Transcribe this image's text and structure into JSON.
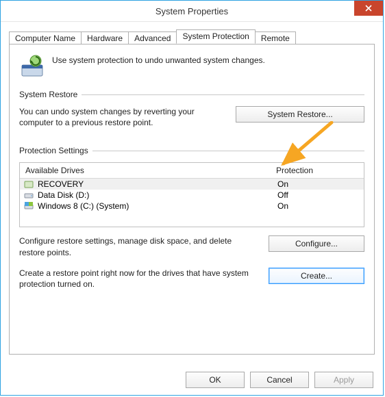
{
  "window": {
    "title": "System Properties"
  },
  "tabs": {
    "computer_name": "Computer Name",
    "hardware": "Hardware",
    "advanced": "Advanced",
    "system_protection": "System Protection",
    "remote": "Remote"
  },
  "intro_text": "Use system protection to undo unwanted system changes.",
  "restore": {
    "heading": "System Restore",
    "text": "You can undo system changes by reverting your computer to a previous restore point.",
    "button": "System Restore..."
  },
  "protection": {
    "heading": "Protection Settings",
    "col_drive": "Available Drives",
    "col_prot": "Protection",
    "drives": [
      {
        "name": "RECOVERY",
        "status": "On",
        "icon": "drive-recovery"
      },
      {
        "name": "Data Disk (D:)",
        "status": "Off",
        "icon": "drive-data"
      },
      {
        "name": "Windows 8 (C:) (System)",
        "status": "On",
        "icon": "drive-system"
      }
    ],
    "configure_text": "Configure restore settings, manage disk space, and delete restore points.",
    "configure_button": "Configure...",
    "create_text": "Create a restore point right now for the drives that have system protection turned on.",
    "create_button": "Create..."
  },
  "footer": {
    "ok": "OK",
    "cancel": "Cancel",
    "apply": "Apply"
  },
  "colors": {
    "arrow": "#f6a623"
  }
}
